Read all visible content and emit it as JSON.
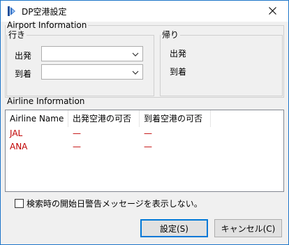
{
  "window": {
    "title": "DP空港設定",
    "close_glyph": "✕"
  },
  "airport_info": {
    "legend": "Airport Information",
    "outbound": {
      "legend": "行き",
      "departure_label": "出発",
      "arrival_label": "到着",
      "departure_value": "",
      "arrival_value": ""
    },
    "return": {
      "legend": "帰り",
      "departure_label": "出発",
      "arrival_label": "到着"
    }
  },
  "airline_info": {
    "legend": "Airline Information",
    "columns": [
      "Airline Name",
      "出発空港の可否",
      "到着空港の可否"
    ],
    "rows": [
      {
        "name": "JAL",
        "departure": "—",
        "arrival": "—"
      },
      {
        "name": "ANA",
        "departure": "—",
        "arrival": "—"
      }
    ],
    "row_color": "#c00000"
  },
  "options": {
    "suppress_warning_label": "検索時の開始日警告メッセージを表示しない。",
    "suppress_warning_checked": false
  },
  "buttons": {
    "ok_label": "設定(S)",
    "cancel_label": "キャンセル(C)"
  },
  "icons": {
    "app": "app-logo-icon",
    "close": "close-icon",
    "dropdown": "chevron-down-icon"
  },
  "colors": {
    "accent": "#0078d7",
    "window_border": "#1d75c9"
  }
}
